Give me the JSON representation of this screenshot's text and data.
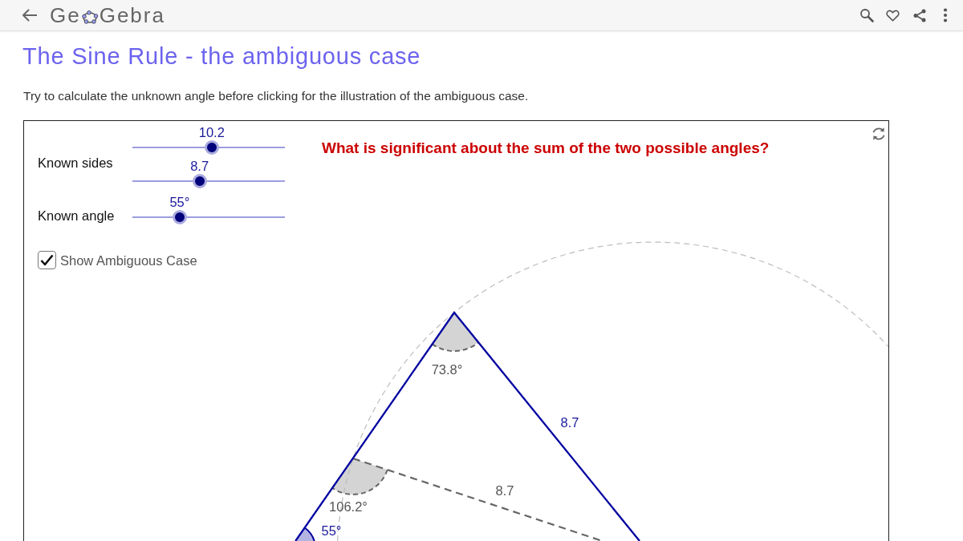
{
  "header": {
    "logo": {
      "text_before_icon": "Ge",
      "text_after_icon": "Gebra"
    }
  },
  "title": "The Sine Rule - the ambiguous case",
  "description": "Try to calculate the unknown angle before clicking for the illustration of the ambiguous case.",
  "applet": {
    "slider_groups": [
      {
        "label": "Known sides",
        "sliders": [
          {
            "reading": "10.2",
            "level": 0.52
          },
          {
            "reading": "8.7",
            "level": 0.44
          }
        ]
      },
      {
        "label": "Known angle",
        "sliders": [
          {
            "reading": "55°",
            "level": 0.31
          }
        ]
      }
    ],
    "question": "What is significant about the sum of the two possible angles?",
    "checkbox": {
      "label": "Show Ambiguous Case",
      "checked": true
    },
    "diagram": {
      "labels": [
        {
          "text": "73.8°",
          "color": "#555555"
        },
        {
          "text": "8.7",
          "color": "#1a1a9c"
        },
        {
          "text": "8.7",
          "color": "#555555"
        },
        {
          "text": "106.2°",
          "color": "#555555"
        },
        {
          "text": "55°",
          "color": "#1a1a9c"
        }
      ]
    }
  }
}
